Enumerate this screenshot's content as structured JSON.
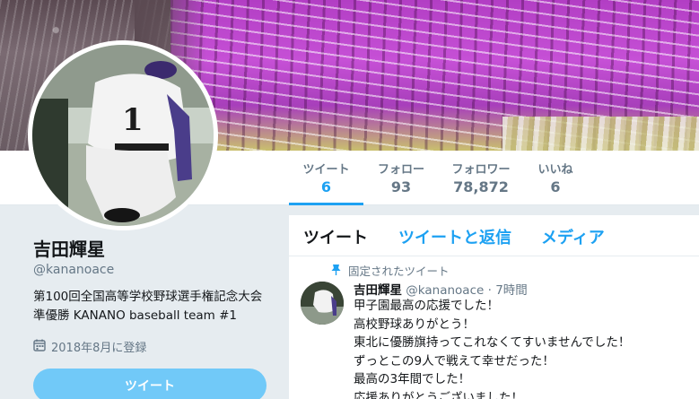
{
  "profile_nav": {
    "tabs": [
      {
        "label": "ツイート",
        "value": "6",
        "active": true
      },
      {
        "label": "フォロー",
        "value": "93",
        "active": false
      },
      {
        "label": "フォロワー",
        "value": "78,872",
        "active": false
      },
      {
        "label": "いいね",
        "value": "6",
        "active": false
      }
    ]
  },
  "profile": {
    "name": "吉田輝星",
    "handle": "@kananoace",
    "bio": "第100回全国高等学校野球選手権記念大会準優勝 KANANO baseball team #1",
    "joined": "2018年8月に登録",
    "joined_icon": "calendar-icon",
    "tweet_button": "ツイート"
  },
  "timeline": {
    "tabs": [
      "ツイート",
      "ツイートと返信",
      "メディア"
    ],
    "pinned_label": "固定されたツイート",
    "pinned_icon": "pin-icon",
    "tweet": {
      "name": "吉田輝星",
      "handle": "@kananoace",
      "dot": "·",
      "time": "7時間",
      "lines": [
        "甲子園最高の応援でした！",
        "高校野球ありがとう！",
        "東北に優勝旗持ってこれなくてすいませんでした！",
        "ずっとこの9人で戦えて幸せだった！",
        "最高の3年間でした！",
        "応援ありがとうございました！"
      ]
    }
  },
  "colors": {
    "accent": "#1da1f2",
    "button": "#71c9f8",
    "muted": "#657786",
    "background": "#e6ecf0"
  }
}
